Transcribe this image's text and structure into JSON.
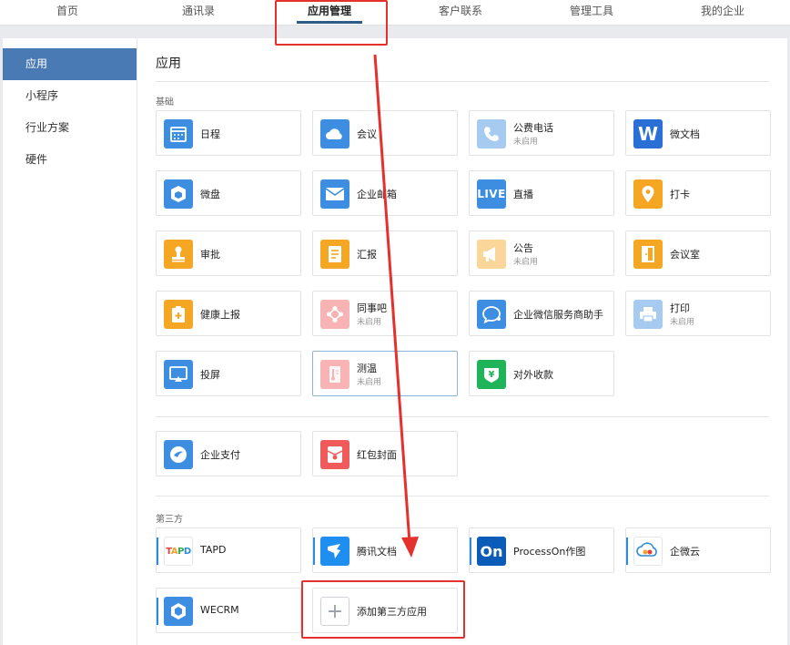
{
  "topnav": {
    "tabs": [
      {
        "label": "首页"
      },
      {
        "label": "通讯录"
      },
      {
        "label": "应用管理",
        "active": true
      },
      {
        "label": "客户联系"
      },
      {
        "label": "管理工具"
      },
      {
        "label": "我的企业"
      }
    ]
  },
  "sidebar": {
    "items": [
      {
        "label": "应用",
        "active": true
      },
      {
        "label": "小程序"
      },
      {
        "label": "行业方案"
      },
      {
        "label": "硬件"
      }
    ]
  },
  "main": {
    "title": "应用",
    "basic_label": "基础",
    "third_party_label": "第三方",
    "basic_apps": [
      {
        "name": "日程",
        "icon": "calendar-icon",
        "color": "#3d8de0"
      },
      {
        "name": "会议",
        "icon": "meeting-cloud-icon",
        "color": "#3d8de0"
      },
      {
        "name": "公费电话",
        "status": "未启用",
        "icon": "phone-icon",
        "color": "#3d8de0",
        "disabled": true
      },
      {
        "name": "微文档",
        "icon": "document-w-icon",
        "color": "#2a6fd6"
      },
      {
        "name": "微盘",
        "icon": "drive-icon",
        "color": "#3d8de0"
      },
      {
        "name": "企业邮箱",
        "icon": "mail-icon",
        "color": "#3d8de0"
      },
      {
        "name": "直播",
        "icon": "live-icon",
        "color": "#3d8de0"
      },
      {
        "name": "打卡",
        "icon": "location-pin-icon",
        "color": "#f5a623"
      },
      {
        "name": "审批",
        "icon": "stamp-icon",
        "color": "#f5a623"
      },
      {
        "name": "汇报",
        "icon": "report-icon",
        "color": "#f5a623"
      },
      {
        "name": "公告",
        "status": "未启用",
        "icon": "megaphone-icon",
        "color": "#f5a623",
        "disabled": true
      },
      {
        "name": "会议室",
        "icon": "door-icon",
        "color": "#f5a623"
      },
      {
        "name": "健康上报",
        "icon": "health-icon",
        "color": "#f5a623"
      },
      {
        "name": "同事吧",
        "status": "未启用",
        "icon": "network-icon",
        "color": "#f05a5a",
        "disabled": true
      },
      {
        "name": "企业微信服务商助手",
        "icon": "chat-bubble-icon",
        "color": "#3d8de0"
      },
      {
        "name": "打印",
        "status": "未启用",
        "icon": "printer-icon",
        "color": "#3d8de0",
        "disabled": true
      },
      {
        "name": "投屏",
        "icon": "screen-cast-icon",
        "color": "#3d8de0"
      },
      {
        "name": "测温",
        "status": "未启用",
        "icon": "thermometer-icon",
        "color": "#f05a5a",
        "disabled": true,
        "selected": true
      },
      {
        "name": "对外收款",
        "icon": "yuan-payment-icon",
        "color": "#1fb35a"
      }
    ],
    "pay_apps": [
      {
        "name": "企业支付",
        "icon": "wallet-icon",
        "color": "#3d8de0"
      },
      {
        "name": "红包封面",
        "icon": "red-packet-icon",
        "color": "#f05a5a"
      }
    ],
    "third_party_apps": [
      {
        "name": "TAPD",
        "icon": "tapd-logo-icon",
        "logo_text": "TAPD"
      },
      {
        "name": "腾讯文档",
        "icon": "tencent-docs-icon",
        "color": "#1f8ef1"
      },
      {
        "name": "ProcessOn作图",
        "icon": "processon-logo-icon",
        "color": "#0b5bb8",
        "logo_text": "On"
      },
      {
        "name": "企微云",
        "icon": "qiweiyun-logo-icon"
      },
      {
        "name": "WECRM",
        "icon": "wecrm-logo-icon",
        "color": "#3d8de0"
      },
      {
        "name": "添加第三方应用",
        "icon": "plus-icon",
        "add": true
      }
    ]
  }
}
